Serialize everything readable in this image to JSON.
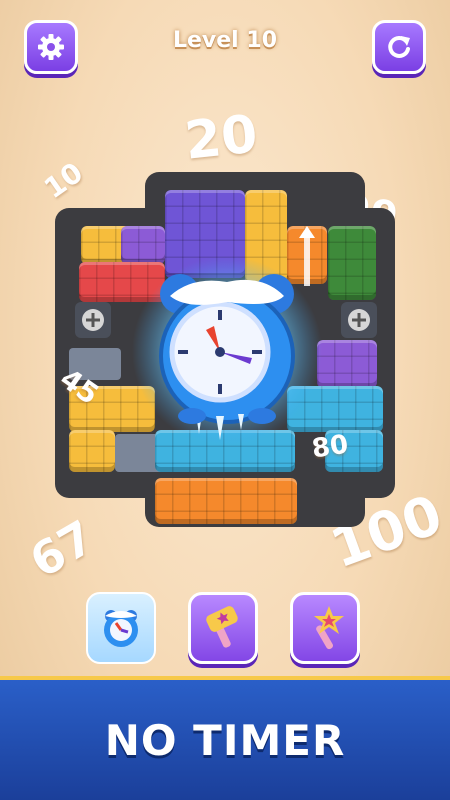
{
  "header": {
    "level_title": "Level 10",
    "settings_icon": "gear-icon",
    "restart_icon": "restart-icon"
  },
  "floating_numbers": {
    "n20": "20",
    "n10": "10",
    "n99": "99",
    "n45": "45",
    "n80": "80",
    "n67": "67",
    "n100": "100"
  },
  "boosters": [
    {
      "name": "freeze-clock",
      "icon": "frozen-clock-icon",
      "active": true
    },
    {
      "name": "hammer",
      "icon": "hammer-icon",
      "active": false
    },
    {
      "name": "magic-wand",
      "icon": "magic-wand-icon",
      "active": false
    }
  ],
  "banner": {
    "text": "NO TIMER"
  },
  "colors": {
    "accent_purple": "#8347e6",
    "banner_blue": "#1b3f9a",
    "block_orange": "#f5892c",
    "block_yellow": "#f6bd3c",
    "block_red": "#e5484a",
    "block_purple": "#6f55d6",
    "block_green": "#3e8a3a",
    "block_blue": "#3fb3e0",
    "block_violet": "#8c5bd6"
  }
}
